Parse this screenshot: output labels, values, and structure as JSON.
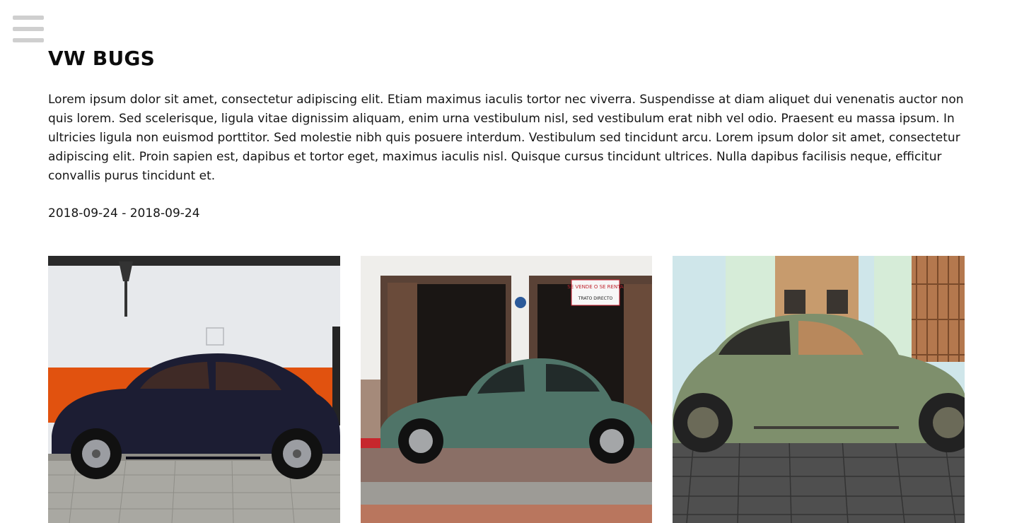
{
  "menu": {
    "icon": "hamburger-menu-icon"
  },
  "page": {
    "title": "VW BUGS",
    "description": "Lorem ipsum dolor sit amet, consectetur adipiscing elit. Etiam maximus iaculis tortor nec viverra. Suspendisse at diam aliquet dui venenatis auctor non quis lorem. Sed scelerisque, ligula vitae dignissim aliquam, enim urna vestibulum nisl, sed vestibulum erat nibh vel odio. Praesent eu massa ipsum. In ultricies ligula non euismod porttitor. Sed molestie nibh quis posuere interdum. Vestibulum sed tincidunt arcu. Lorem ipsum dolor sit amet, consectetur adipiscing elit. Proin sapien est, dapibus et tortor eget, maximus iaculis nisl. Quisque cursus tincidunt ultrices. Nulla dapibus facilisis neque, efficitur convallis purus tincidunt et.",
    "dates": "2018-09-24 - 2018-09-24"
  },
  "gallery": {
    "photos": [
      {
        "subject": "dark navy VW Beetle in front of white and orange wall",
        "car_color": "#1c1d33"
      },
      {
        "subject": "teal-green VW Beetle in front of shop doors",
        "car_color": "#4f7468",
        "sign_line1": "SE VENDE O SE RENTA",
        "sign_line2": "TRATO DIRECTO"
      },
      {
        "subject": "sage-green VW Beetle in front of pastel wall",
        "car_color": "#7e8f6c"
      }
    ]
  }
}
